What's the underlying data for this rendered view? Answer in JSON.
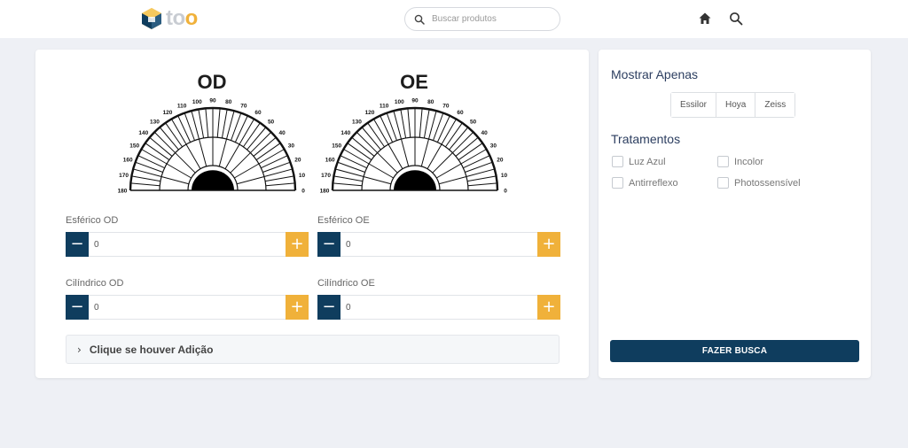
{
  "header": {
    "logo_text": "too",
    "search_placeholder": "Buscar produtos",
    "icons": [
      "home-icon",
      "search-icon"
    ]
  },
  "eyes": {
    "left": {
      "title": "OD"
    },
    "right": {
      "title": "OE"
    },
    "dial_ticks": [
      "180",
      "170",
      "160",
      "150",
      "140",
      "130",
      "120",
      "110",
      "100",
      "90",
      "80",
      "70",
      "60",
      "50",
      "40",
      "30",
      "20",
      "10",
      "0"
    ]
  },
  "fields": {
    "esferico_od": {
      "label": "Esférico OD",
      "value": "0"
    },
    "esferico_oe": {
      "label": "Esférico OE",
      "value": "0"
    },
    "cilindrico_od": {
      "label": "Cilíndrico OD",
      "value": "0"
    },
    "cilindrico_oe": {
      "label": "Cilíndrico OE",
      "value": "0"
    },
    "minus_symbol": "−",
    "plus_symbol": "+"
  },
  "accordion": {
    "chevron": "›",
    "label": "Clique se houver Adição"
  },
  "filters": {
    "show_only_title": "Mostrar Apenas",
    "brands": [
      "Essilor",
      "Hoya",
      "Zeiss"
    ],
    "treatments_title": "Tratamentos",
    "treatments": [
      "Luz Azul",
      "Incolor",
      "Antirreflexo",
      "Photossensível"
    ],
    "search_button": "FAZER BUSCA"
  },
  "colors": {
    "primary": "#0f3d5e",
    "accent": "#f0b13a",
    "title": "#2c3e60"
  }
}
